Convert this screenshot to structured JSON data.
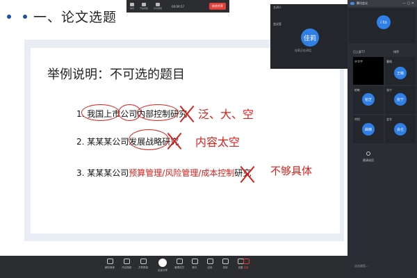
{
  "slide": {
    "section_title": "一、论文选题",
    "heading": "举例说明：不可选的题目",
    "items": [
      {
        "num": "1.",
        "text": "我国上市公司内部控制研究",
        "annotation": "泛、大、空"
      },
      {
        "num": "2.",
        "text": "某某某公司发展战略研究",
        "annotation": "内容太空"
      },
      {
        "num": "3.",
        "prefix": "某某某公司",
        "red_text": "预算管理/风险管理/成本控制",
        "suffix": "研究",
        "annotation": "不够具体"
      }
    ]
  },
  "top_toolbar": {
    "buttons": [
      "静音",
      "开启视频",
      "共享屏幕"
    ],
    "time": "00:09:57",
    "end": "结束共享"
  },
  "speaker": {
    "window_title": "主讲人",
    "label": "佳莉",
    "name_small": "会议室",
    "sub": "佳莉正在讲话"
  },
  "panel": {
    "top_label": "腾讯会议",
    "main_avatar": "i to",
    "shared_label": "已上屏77",
    "sort_label": "排序",
    "participants": [
      {
        "name": "许华宇",
        "avatar": ""
      },
      {
        "name": "曹格",
        "avatar": "王萌"
      },
      {
        "name": "柏乾",
        "avatar": "柏芝"
      },
      {
        "name": "张宁",
        "avatar": "张宁"
      },
      {
        "name": "刘恒",
        "avatar": "曲楠"
      },
      {
        "name": "会仑",
        "avatar": "会仑"
      }
    ],
    "invite": "邀请成员",
    "chat_placeholder": "点击说话..."
  },
  "bottom_toolbar": {
    "buttons": [
      "解除静音",
      "开启视频",
      "共享屏幕",
      "结束共享",
      "管理成员",
      "聊天",
      "应用",
      "录制",
      "设置",
      "结束"
    ]
  },
  "colors": {
    "accent_red": "#d9201c",
    "brand_blue": "#2f7fe6",
    "dark_panel": "#2a2d33"
  }
}
